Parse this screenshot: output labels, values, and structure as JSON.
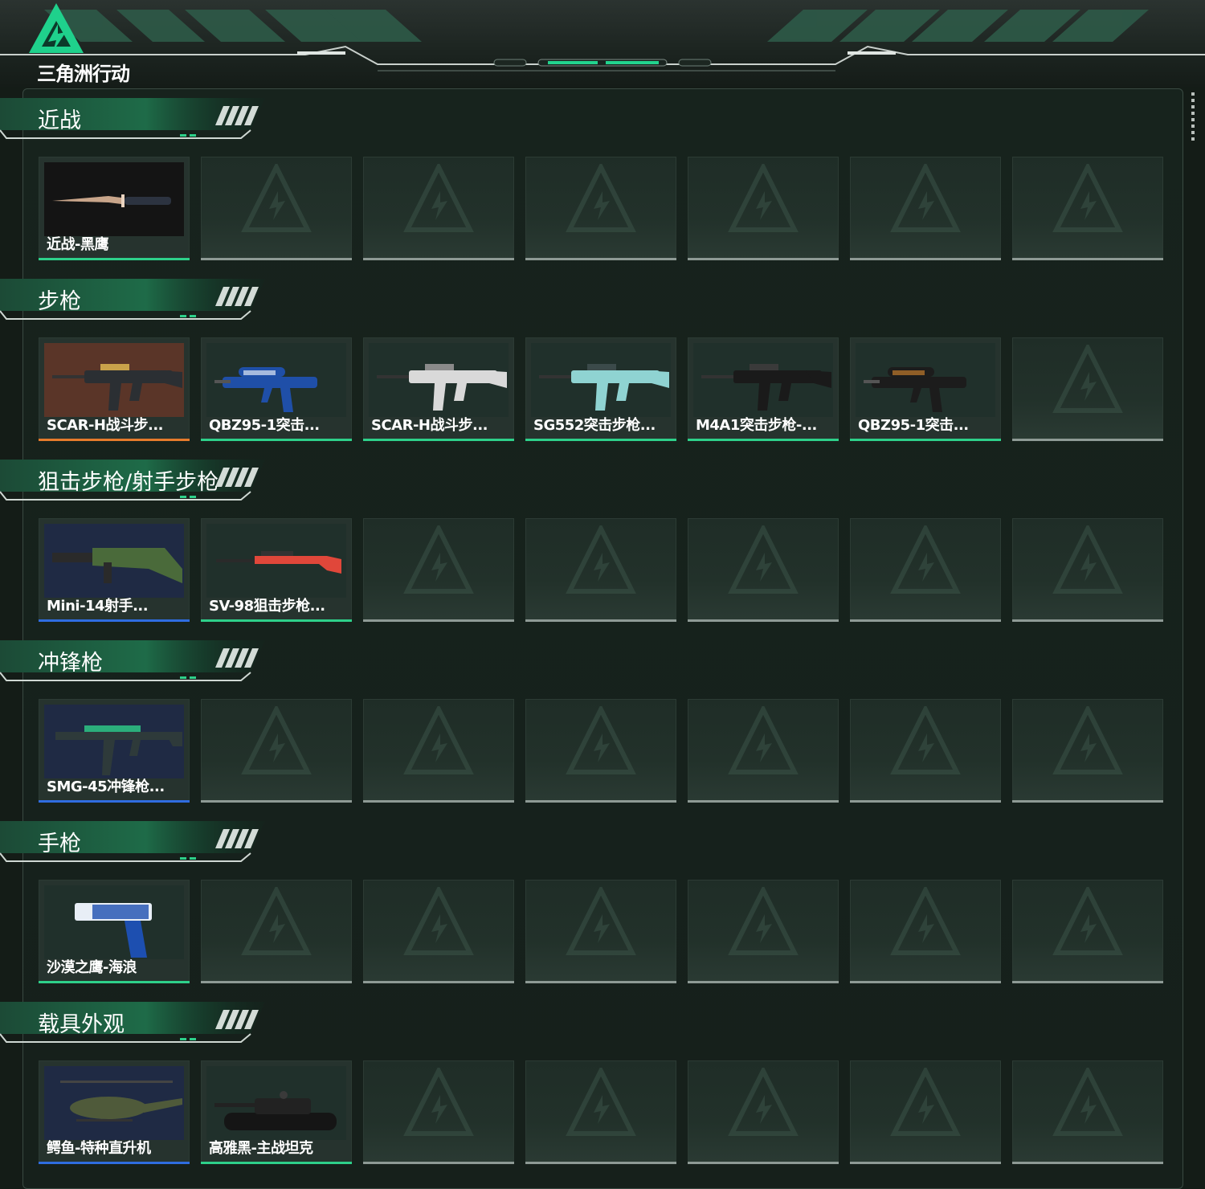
{
  "header": {
    "brand": "三角洲行动",
    "colors": {
      "accent": "#1fd18c",
      "panel": "#16201b"
    }
  },
  "sections": [
    {
      "title": "近战",
      "slots": 7,
      "items": [
        {
          "name": "近战-黑鹰",
          "rarity": "green",
          "icon": "knife-art"
        }
      ]
    },
    {
      "title": "步枪",
      "slots": 7,
      "items": [
        {
          "name": "SCAR-H战斗步...",
          "rarity": "orange",
          "icon": "rifle-art"
        },
        {
          "name": "QBZ95-1突击...",
          "rarity": "green",
          "icon": "bullpup-art"
        },
        {
          "name": "SCAR-H战斗步...",
          "rarity": "green",
          "icon": "rifle-art"
        },
        {
          "name": "SG552突击步枪...",
          "rarity": "green",
          "icon": "rifle-art"
        },
        {
          "name": "M4A1突击步枪-...",
          "rarity": "green",
          "icon": "rifle-art"
        },
        {
          "name": "QBZ95-1突击...",
          "rarity": "green",
          "icon": "bullpup-art"
        }
      ]
    },
    {
      "title": "狙击步枪/射手步枪",
      "slots": 7,
      "items": [
        {
          "name": "Mini-14射手...",
          "rarity": "blue",
          "icon": "marksman-art"
        },
        {
          "name": "SV-98狙击步枪...",
          "rarity": "green",
          "icon": "sniper-art"
        }
      ]
    },
    {
      "title": "冲锋枪",
      "slots": 7,
      "items": [
        {
          "name": "SMG-45冲锋枪...",
          "rarity": "blue",
          "icon": "smg-art"
        }
      ]
    },
    {
      "title": "手枪",
      "slots": 7,
      "items": [
        {
          "name": "沙漠之鹰-海浪",
          "rarity": "green",
          "icon": "pistol-art"
        }
      ]
    },
    {
      "title": "载具外观",
      "slots": 7,
      "items": [
        {
          "name": "鳄鱼-特种直升机",
          "rarity": "blue",
          "icon": "helicopter-art"
        },
        {
          "name": "高雅黑-主战坦克",
          "rarity": "green",
          "icon": "tank-art"
        }
      ]
    }
  ],
  "art_colors": {
    "section1_item0": {
      "bg": "#141414",
      "body": "#c8a58a",
      "accent": "#e8d2bf"
    },
    "section2_item0": {
      "bg": "#5a3528",
      "body": "#2b2f33",
      "accent": "#c9a24a"
    },
    "section2_item1": {
      "bg": "#20302b",
      "body": "#1f4fa8",
      "accent": "#dfe8f5"
    },
    "section2_item2": {
      "bg": "#20302b",
      "body": "#d9d9d9",
      "accent": "#8a8a8a"
    },
    "section2_item3": {
      "bg": "#20302b",
      "body": "#8fd3d2",
      "accent": "#3b4a4a"
    },
    "section2_item4": {
      "bg": "#20302b",
      "body": "#1a1a1a",
      "accent": "#3a3a3a"
    },
    "section2_item5": {
      "bg": "#20302b",
      "body": "#1c1c1c",
      "accent": "#c07a2c"
    },
    "section3_item0": {
      "bg": "#1f2a44",
      "body": "#4a6a3a",
      "accent": "#2a2a2a"
    },
    "section3_item1": {
      "bg": "#20302b",
      "body": "#e0473a",
      "accent": "#333333"
    },
    "section4_item0": {
      "bg": "#1f2a44",
      "body": "#2e3a3a",
      "accent": "#2ed08a"
    },
    "section5_item0": {
      "bg": "#20302b",
      "body": "#1d4fb0",
      "accent": "#e8eef6"
    },
    "section6_item0": {
      "bg": "#1f2a44",
      "body": "#4f5a3a",
      "accent": "#2a2a2a"
    },
    "section6_item1": {
      "bg": "#20302b",
      "body": "#151515",
      "accent": "#3a3a3a"
    }
  }
}
